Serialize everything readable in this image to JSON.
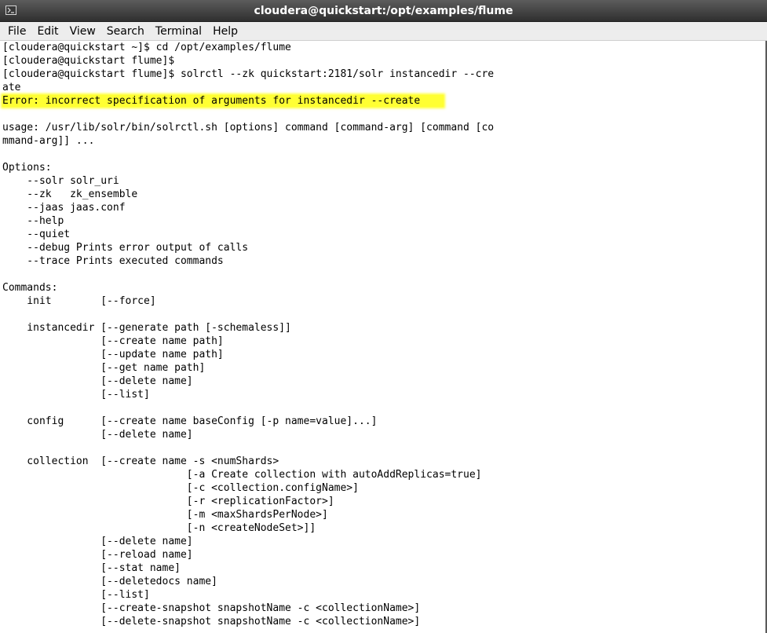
{
  "window": {
    "title": "cloudera@quickstart:/opt/examples/flume",
    "icon": "terminal-icon"
  },
  "menu": {
    "items": [
      {
        "name": "menu-file",
        "label": "File"
      },
      {
        "name": "menu-edit",
        "label": "Edit"
      },
      {
        "name": "menu-view",
        "label": "View"
      },
      {
        "name": "menu-search",
        "label": "Search"
      },
      {
        "name": "menu-terminal",
        "label": "Terminal"
      },
      {
        "name": "menu-help",
        "label": "Help"
      }
    ]
  },
  "colors": {
    "highlight": "#ffff33",
    "titlebar": "#3a3a3a"
  },
  "terminal": {
    "lines": [
      "[cloudera@quickstart ~]$ cd /opt/examples/flume",
      "[cloudera@quickstart flume]$",
      "[cloudera@quickstart flume]$ solrctl --zk quickstart:2181/solr instancedir --cre",
      "ate",
      "Error: incorrect specification of arguments for instancedir --create",
      "",
      "usage: /usr/lib/solr/bin/solrctl.sh [options] command [command-arg] [command [co",
      "mmand-arg]] ...",
      "",
      "Options:",
      "    --solr solr_uri",
      "    --zk   zk_ensemble",
      "    --jaas jaas.conf",
      "    --help",
      "    --quiet",
      "    --debug Prints error output of calls",
      "    --trace Prints executed commands",
      "",
      "Commands:",
      "    init        [--force]",
      "",
      "    instancedir [--generate path [-schemaless]]",
      "                [--create name path]",
      "                [--update name path]",
      "                [--get name path]",
      "                [--delete name]",
      "                [--list]",
      "",
      "    config      [--create name baseConfig [-p name=value]...]",
      "                [--delete name]",
      "",
      "    collection  [--create name -s <numShards>",
      "                              [-a Create collection with autoAddReplicas=true]",
      "                              [-c <collection.configName>]",
      "                              [-r <replicationFactor>]",
      "                              [-m <maxShardsPerNode>]",
      "                              [-n <createNodeSet>]]",
      "                [--delete name]",
      "                [--reload name]",
      "                [--stat name]",
      "                [--deletedocs name]",
      "                [--list]",
      "                [--create-snapshot snapshotName -c <collectionName>]",
      "                [--delete-snapshot snapshotName -c <collectionName>]"
    ],
    "highlighted_line": 4
  }
}
